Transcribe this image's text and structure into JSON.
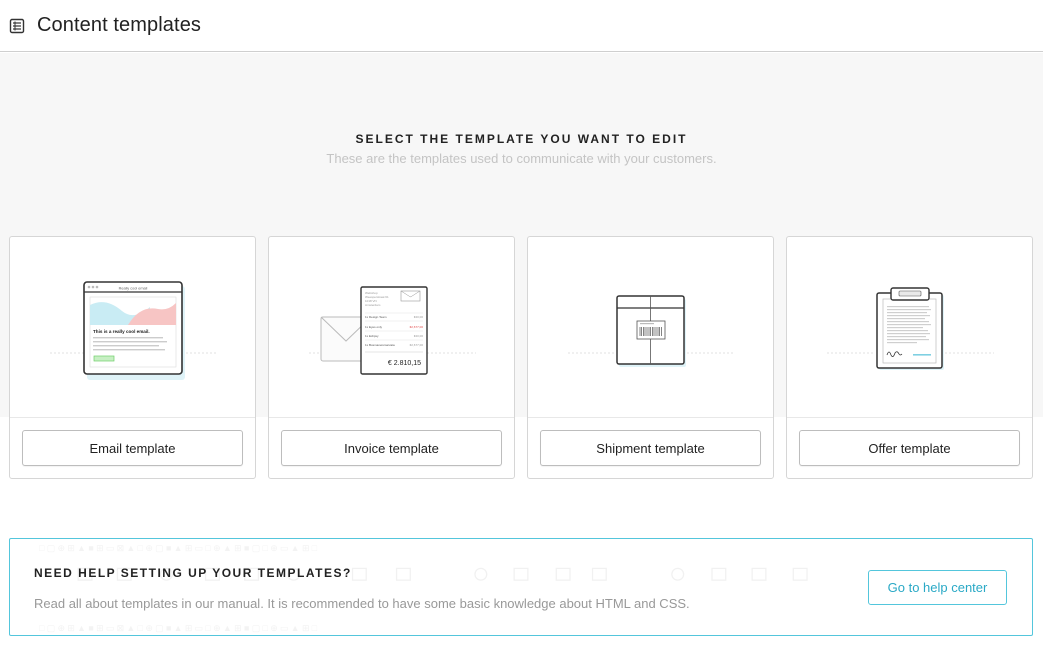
{
  "header": {
    "icon": "template-list-icon",
    "title": "Content templates"
  },
  "intro": {
    "headline": "SELECT THE TEMPLATE YOU WANT TO EDIT",
    "subtitle": "These are the templates used to communicate with your customers."
  },
  "cards": [
    {
      "button_label": "Email template",
      "illustration": "email-illustration-icon",
      "browser_title": "Really cool email",
      "email_heading": "This is a really cool email."
    },
    {
      "button_label": "Invoice template",
      "illustration": "invoice-illustration-icon",
      "address_lines": [
        "Webshop",
        "Weesperstraat 61",
        "1018 VN",
        "Amsterdam"
      ],
      "items": [
        {
          "label": "1x  Design Team",
          "price": "€20,00"
        },
        {
          "label": "1x  Eyes only",
          "price": "€2,677,00"
        },
        {
          "label": "1x  Eclipsy",
          "price": "€20,00"
        },
        {
          "label": "1x  Bosmaneismarvata",
          "price": "€2,677,00"
        }
      ],
      "total": "€ 2.810,15"
    },
    {
      "button_label": "Shipment template",
      "illustration": "shipment-box-icon"
    },
    {
      "button_label": "Offer template",
      "illustration": "offer-clipboard-icon"
    }
  ],
  "help": {
    "title": "NEED HELP SETTING UP YOUR TEMPLATES?",
    "text": "Read all about templates in our manual. It is recommended to have some basic knowledge about HTML and CSS.",
    "button_label": "Go to help center"
  },
  "colors": {
    "accent": "#53c6dc",
    "accent_text": "#2aa9c6",
    "email_wave_blue": "#c9ecf4",
    "email_wave_pink": "#f7c5c4",
    "email_button_green": "#c7efc3",
    "invoice_red": "#e24a4a"
  }
}
